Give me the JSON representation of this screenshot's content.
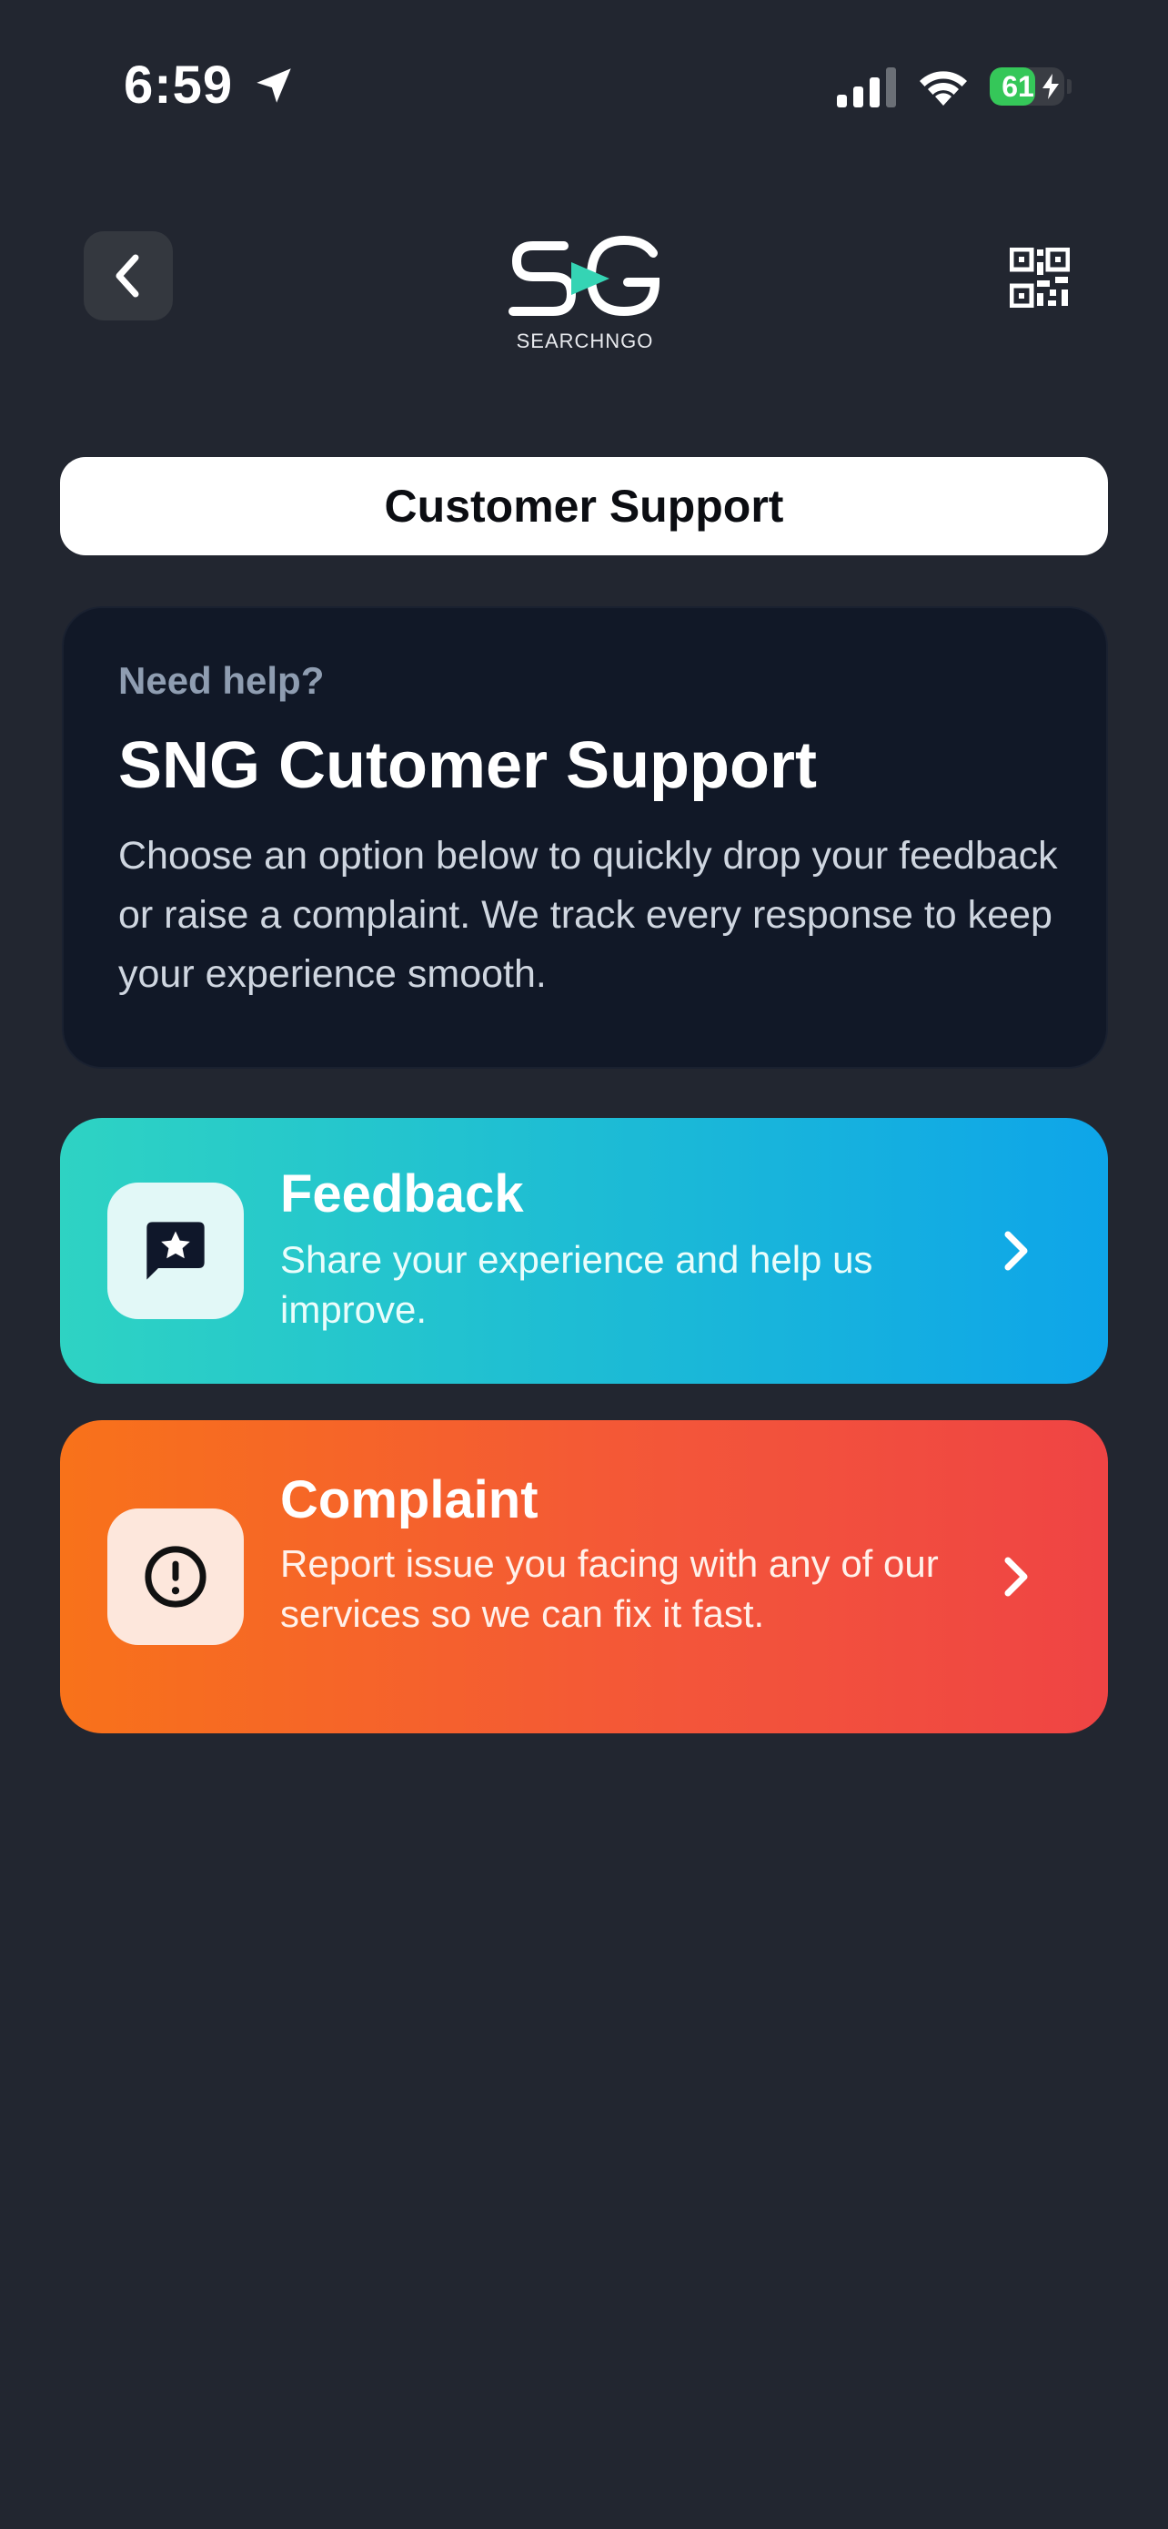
{
  "status_bar": {
    "time": "6:59",
    "battery_level": "61",
    "battery_percent": 61,
    "location_icon": "location-arrow-icon",
    "signal_icon": "cellular-signal-icon",
    "wifi_icon": "wifi-icon",
    "battery_icon": "battery-charging-icon"
  },
  "header": {
    "back_icon": "chevron-left-icon",
    "logo_text": "SEARCHNGO",
    "qr_icon": "qr-code-icon"
  },
  "page_title": "Customer Support",
  "intro": {
    "kicker": "Need help?",
    "title": "SNG Cutomer Support",
    "description": "Choose an option below to quickly drop your feedback or raise a complaint. We track every response to keep your experience smooth."
  },
  "options": [
    {
      "title": "Feedback",
      "description": "Share your experience and help us improve.",
      "icon": "message-star-icon",
      "gradient": [
        "#2ed3c3",
        "#0ea5e9"
      ]
    },
    {
      "title": "Complaint",
      "description": "Report issue you facing with any of our services so we can fix it fast.",
      "icon": "alert-circle-icon",
      "gradient": [
        "#f8721a",
        "#ef4444"
      ]
    }
  ],
  "colors": {
    "background": "#222630",
    "card": "#111827",
    "logo_accent": "#35d4b4"
  }
}
